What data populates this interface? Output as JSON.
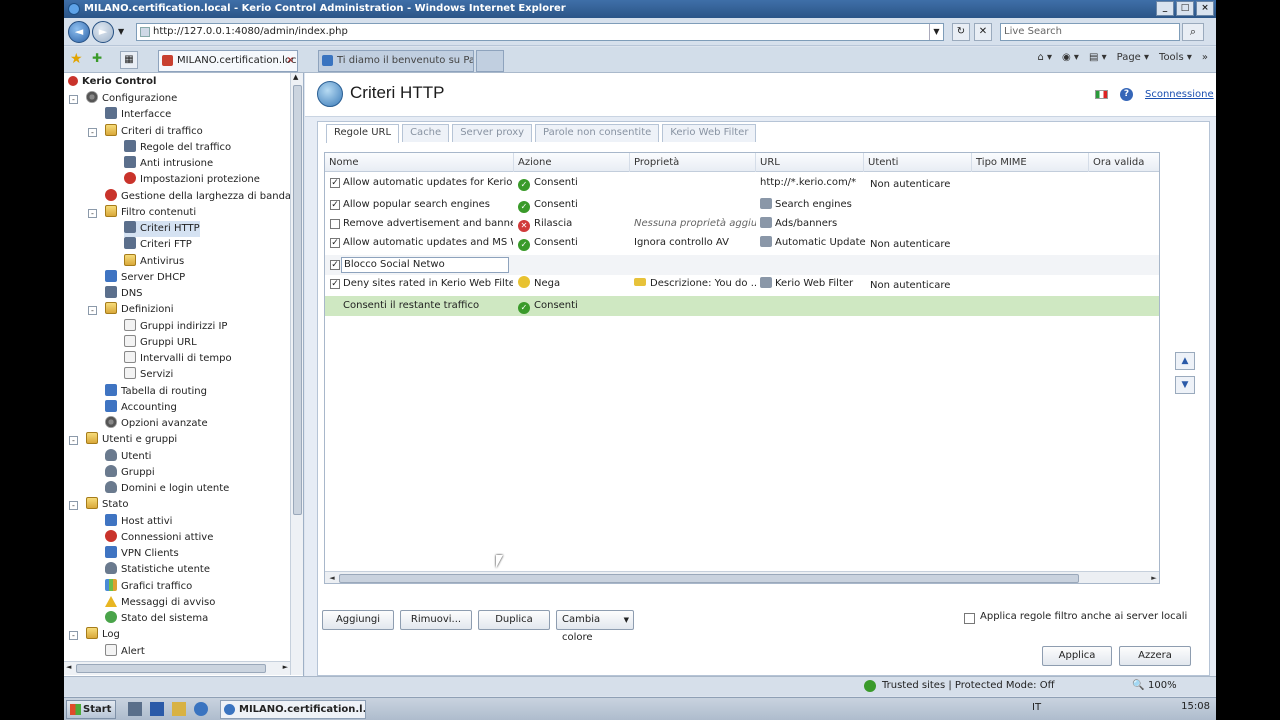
{
  "window": {
    "title": "MILANO.certification.local - Kerio Control Administration - Windows Internet Explorer"
  },
  "browser": {
    "address": "http://127.0.0.1:4080/admin/index.php",
    "search_placeholder": "Live Search",
    "tabs": [
      {
        "label": "MILANO.certification.loc...",
        "active": true
      },
      {
        "label": "Ti diamo il benvenuto su Pac...",
        "active": false
      }
    ],
    "commands": [
      "Page",
      "Tools"
    ]
  },
  "tree": {
    "root": "Kerio Control",
    "nodes": [
      {
        "label": "Configurazione",
        "level": 1,
        "icon": "gear-icon",
        "expander": "-"
      },
      {
        "label": "Interfacce",
        "level": 2,
        "icon": "network-icon"
      },
      {
        "label": "Criteri di traffico",
        "level": 2,
        "icon": "folder-icon",
        "expander": "-"
      },
      {
        "label": "Regole del traffico",
        "level": 3,
        "icon": "rules-icon"
      },
      {
        "label": "Anti intrusione",
        "level": 3,
        "icon": "shield-icon"
      },
      {
        "label": "Impostazioni protezione",
        "level": 3,
        "icon": "protection-icon"
      },
      {
        "label": "Gestione della larghezza di banda e Q",
        "level": 2,
        "icon": "bandwidth-icon"
      },
      {
        "label": "Filtro contenuti",
        "level": 2,
        "icon": "folder-icon",
        "expander": "-"
      },
      {
        "label": "Criteri HTTP",
        "level": 3,
        "icon": "http-icon",
        "selected": true
      },
      {
        "label": "Criteri FTP",
        "level": 3,
        "icon": "ftp-icon"
      },
      {
        "label": "Antivirus",
        "level": 3,
        "icon": "antivirus-icon"
      },
      {
        "label": "Server DHCP",
        "level": 2,
        "icon": "dhcp-icon"
      },
      {
        "label": "DNS",
        "level": 2,
        "icon": "dns-icon"
      },
      {
        "label": "Definizioni",
        "level": 2,
        "icon": "folder-icon",
        "expander": "-"
      },
      {
        "label": "Gruppi indirizzi IP",
        "level": 3,
        "icon": "ip-groups-icon"
      },
      {
        "label": "Gruppi URL",
        "level": 3,
        "icon": "url-groups-icon"
      },
      {
        "label": "Intervalli di tempo",
        "level": 3,
        "icon": "time-icon"
      },
      {
        "label": "Servizi",
        "level": 3,
        "icon": "services-icon"
      },
      {
        "label": "Tabella di routing",
        "level": 2,
        "icon": "routing-icon"
      },
      {
        "label": "Accounting",
        "level": 2,
        "icon": "accounting-icon"
      },
      {
        "label": "Opzioni avanzate",
        "level": 2,
        "icon": "advanced-icon"
      },
      {
        "label": "Utenti e gruppi",
        "level": 1,
        "icon": "folder-icon",
        "expander": "-"
      },
      {
        "label": "Utenti",
        "level": 2,
        "icon": "user-icon"
      },
      {
        "label": "Gruppi",
        "level": 2,
        "icon": "group-icon"
      },
      {
        "label": "Domini e login utente",
        "level": 2,
        "icon": "domain-icon"
      },
      {
        "label": "Stato",
        "level": 1,
        "icon": "folder-icon",
        "expander": "-"
      },
      {
        "label": "Host attivi",
        "level": 2,
        "icon": "hosts-icon"
      },
      {
        "label": "Connessioni attive",
        "level": 2,
        "icon": "connections-icon"
      },
      {
        "label": "VPN Clients",
        "level": 2,
        "icon": "vpn-icon"
      },
      {
        "label": "Statistiche utente",
        "level": 2,
        "icon": "stats-icon"
      },
      {
        "label": "Grafici traffico",
        "level": 2,
        "icon": "chart-icon"
      },
      {
        "label": "Messaggi di avviso",
        "level": 2,
        "icon": "warning-icon"
      },
      {
        "label": "Stato del sistema",
        "level": 2,
        "icon": "system-icon"
      },
      {
        "label": "Log",
        "level": 1,
        "icon": "folder-icon",
        "expander": "-"
      },
      {
        "label": "Alert",
        "level": 2,
        "icon": "log-icon"
      }
    ]
  },
  "page": {
    "title": "Criteri HTTP",
    "logout": "Sconnessione",
    "tabs": [
      "Regole URL",
      "Cache",
      "Server proxy",
      "Parole non consentite",
      "Kerio Web Filter"
    ],
    "active_tab": 0
  },
  "grid": {
    "columns": [
      "Nome",
      "Azione",
      "Proprietà",
      "URL",
      "Utenti",
      "Tipo MIME",
      "Ora valida"
    ],
    "rows": [
      {
        "checked": true,
        "name": "Allow automatic updates for Kerio so...",
        "action": "Consenti",
        "action_type": "allow",
        "property": "",
        "url": "http://*.kerio.com/*",
        "url_icon": false,
        "users": "Non autenticare"
      },
      {
        "checked": true,
        "name": "Allow popular search engines",
        "action": "Consenti",
        "action_type": "allow",
        "property": "",
        "url": "Search engines",
        "url_icon": true,
        "users": ""
      },
      {
        "checked": false,
        "name": "Remove advertisement and banners",
        "action": "Rilascia",
        "action_type": "drop",
        "property": "Nessuna proprietà aggiu...",
        "property_italic": true,
        "url": "Ads/banners",
        "url_icon": true,
        "users": ""
      },
      {
        "checked": true,
        "name": "Allow automatic updates and MS Wi...",
        "action": "Consenti",
        "action_type": "allow",
        "property": "Ignora controllo AV",
        "url": "Automatic Updates",
        "url_icon": true,
        "users": "Non autenticare"
      },
      {
        "checked": true,
        "name": "Blocco Social Netwo",
        "editing": true,
        "action": "",
        "property": "",
        "url": "",
        "users": ""
      },
      {
        "checked": true,
        "name": "Deny sites rated in Kerio Web Filter ...",
        "action": "Nega",
        "action_type": "deny",
        "property": "Descrizione: You do ...",
        "property_icon": true,
        "url": "Kerio Web Filter",
        "url_icon": true,
        "users": "Non autenticare"
      },
      {
        "checked": null,
        "name": "Consenti il restante traffico",
        "action": "Consenti",
        "action_type": "allow",
        "property": "",
        "url": "",
        "users": "",
        "default": true
      }
    ]
  },
  "buttons": {
    "add": "Aggiungi",
    "remove": "Rimuovi...",
    "duplicate": "Duplica",
    "change_color": "Cambia colore",
    "apply": "Applica",
    "reset": "Azzera"
  },
  "local_servers_label": "Applica regole filtro anche ai server locali",
  "statusbar": {
    "zone": "Trusted sites | Protected Mode: Off",
    "zoom": "100%"
  },
  "taskbar": {
    "start": "Start",
    "item": "MILANO.certification.l...",
    "lang": "IT",
    "time": "15:08"
  }
}
